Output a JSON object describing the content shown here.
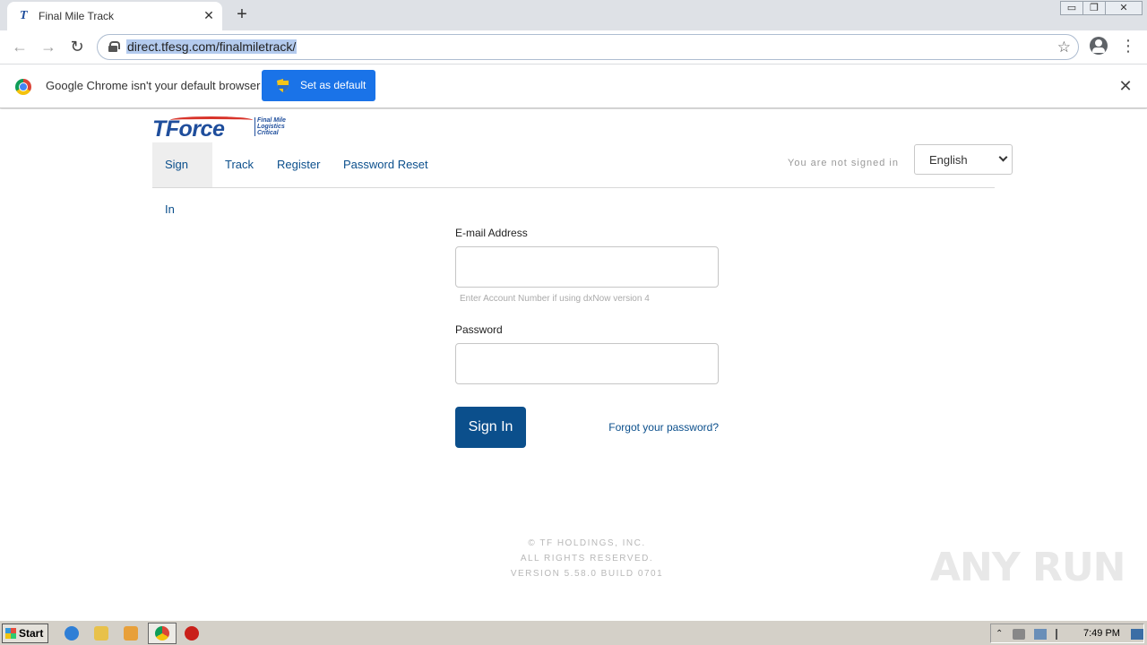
{
  "browser": {
    "tab_title": "Final Mile Track",
    "tab_favicon": "T",
    "url": "direct.tfesg.com/finalmiletrack/",
    "infobar_text": "Google Chrome isn't your default browser",
    "infobar_button": "Set as default"
  },
  "icons": {
    "tab_close": "✕",
    "new_tab": "+",
    "back": "←",
    "forward": "→",
    "reload": "↻",
    "star": "☆",
    "menu": "⋮",
    "infobar_close": "✕",
    "win_minimize": "▭",
    "win_restore": "❐",
    "win_close": "✕"
  },
  "site": {
    "logo_word": "TForce",
    "logo_tag_lines": "Final Mile\nLogistics\nCritical",
    "nav": {
      "signin": "Sign In",
      "track": "Track",
      "register": "Register",
      "password_reset": "Password Reset"
    },
    "status": "You are not signed in",
    "language": "English"
  },
  "form": {
    "email_label": "E-mail Address",
    "email_value": "",
    "email_hint": "Enter Account Number if using dxNow version 4",
    "password_label": "Password",
    "password_value": "",
    "signin_button": "Sign In",
    "forgot_link": "Forgot your password?"
  },
  "footer": {
    "line1": "© TF HOLDINGS, INC.",
    "line2": "ALL RIGHTS RESERVED.",
    "line3": "VERSION 5.58.0 BUILD 0701"
  },
  "watermark": "ANY RUN",
  "taskbar": {
    "start_label": "Start",
    "clock": "7:49 PM"
  },
  "colors": {
    "brand_blue": "#0b4f8c",
    "chrome_blue": "#1a73e8",
    "logo_red": "#d8342b"
  }
}
